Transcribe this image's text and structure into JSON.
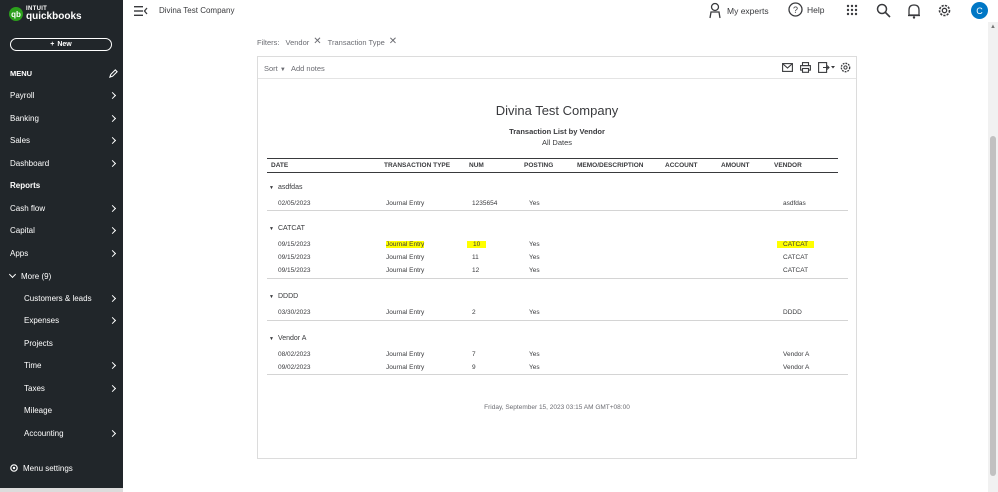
{
  "brand": {
    "line1": "INTUIT",
    "line2": "quickbooks",
    "mark": "qb"
  },
  "sidebar": {
    "new_label": "New",
    "menu_label": "MENU",
    "items": [
      {
        "label": "Payroll"
      },
      {
        "label": "Banking"
      },
      {
        "label": "Sales"
      },
      {
        "label": "Dashboard"
      },
      {
        "label": "Reports"
      },
      {
        "label": "Cash flow"
      },
      {
        "label": "Capital"
      },
      {
        "label": "Apps"
      },
      {
        "label": "More (9)"
      },
      {
        "label": "Customers & leads"
      },
      {
        "label": "Expenses"
      },
      {
        "label": "Projects"
      },
      {
        "label": "Time"
      },
      {
        "label": "Taxes"
      },
      {
        "label": "Mileage"
      },
      {
        "label": "Accounting"
      }
    ],
    "menu_settings_label": "Menu settings"
  },
  "topbar": {
    "company": "Divina Test Company",
    "my_experts": "My experts",
    "help": "Help",
    "avatar_initial": "C"
  },
  "filters": {
    "label": "Filters:",
    "chips": [
      "Vendor",
      "Transaction Type"
    ]
  },
  "report": {
    "sort_label": "Sort",
    "add_notes_label": "Add notes",
    "company": "Divina Test Company",
    "title": "Transaction List by Vendor",
    "date_range": "All Dates",
    "columns": [
      "DATE",
      "TRANSACTION TYPE",
      "NUM",
      "POSTING",
      "MEMO/DESCRIPTION",
      "ACCOUNT",
      "AMOUNT",
      "VENDOR"
    ],
    "groups": [
      {
        "name": "asdfdas",
        "rows": [
          {
            "date": "02/05/2023",
            "type": "Journal Entry",
            "num": "1235654",
            "posting": "Yes",
            "vendor": "asdfdas"
          }
        ]
      },
      {
        "name": "CATCAT",
        "rows": [
          {
            "date": "09/15/2023",
            "type": "Journal Entry",
            "num": "10",
            "posting": "Yes",
            "vendor": "CATCAT"
          },
          {
            "date": "09/15/2023",
            "type": "Journal Entry",
            "num": "11",
            "posting": "Yes",
            "vendor": "CATCAT"
          },
          {
            "date": "09/15/2023",
            "type": "Journal Entry",
            "num": "12",
            "posting": "Yes",
            "vendor": "CATCAT"
          }
        ]
      },
      {
        "name": "DDDD",
        "rows": [
          {
            "date": "03/30/2023",
            "type": "Journal Entry",
            "num": "2",
            "posting": "Yes",
            "vendor": "DDDD"
          }
        ]
      },
      {
        "name": "Vendor A",
        "rows": [
          {
            "date": "08/02/2023",
            "type": "Journal Entry",
            "num": "7",
            "posting": "Yes",
            "vendor": "Vendor A"
          },
          {
            "date": "09/02/2023",
            "type": "Journal Entry",
            "num": "9",
            "posting": "Yes",
            "vendor": "Vendor A"
          }
        ]
      }
    ],
    "timestamp": "Friday, September 15, 2023  03:15 AM GMT+08:00"
  },
  "colors": {
    "sidebar_bg": "#21262a",
    "accent": "#2ca01c",
    "avatar": "#0077c5",
    "highlight": "#ffff00"
  },
  "icons": [
    "hamburger-collapse-icon",
    "my-experts-icon",
    "help-icon",
    "apps-grid-icon",
    "search-icon",
    "bell-icon",
    "gear-icon",
    "email-icon",
    "print-icon",
    "export-icon",
    "report-settings-icon",
    "pencil-icon"
  ]
}
